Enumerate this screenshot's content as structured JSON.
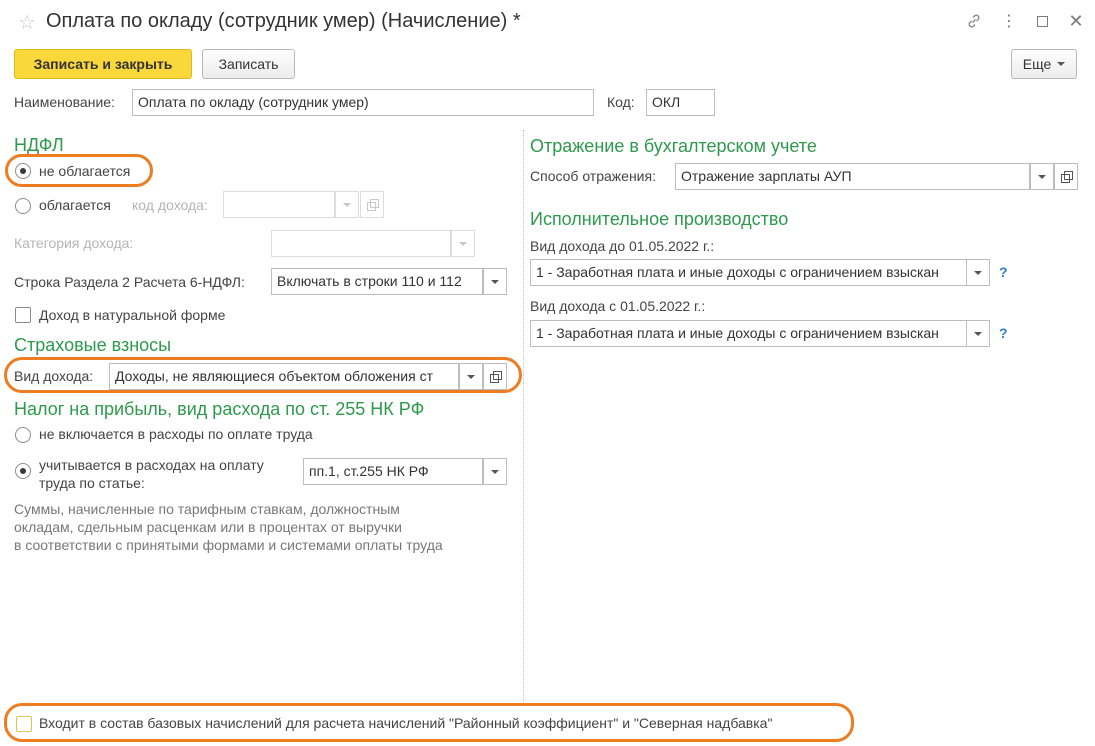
{
  "window": {
    "title": "Оплата по окладу (сотрудник умер) (Начисление) *",
    "icons": [
      "star-icon",
      "link-icon",
      "more-icon",
      "maximize-icon",
      "close-icon"
    ]
  },
  "toolbar": {
    "save_close_label": "Записать и закрыть",
    "save_label": "Записать",
    "more_label": "Еще"
  },
  "header": {
    "name_label": "Наименование:",
    "name_value": "Оплата по окладу (сотрудник умер)",
    "code_label": "Код:",
    "code_value": "ОКЛ"
  },
  "ndfl": {
    "title": "НДФЛ",
    "not_taxed_label": "не облагается",
    "taxed_label": "облагается",
    "income_code_label": "код дохода:",
    "income_category_label": "Категория дохода:",
    "section2_label": "Строка Раздела 2 Расчета 6-НДФЛ:",
    "section2_value": "Включать в строки 110 и 112",
    "in_kind_label": "Доход в натуральной форме",
    "selected": "не облагается"
  },
  "insurance": {
    "title": "Страховые взносы",
    "income_type_label": "Вид дохода:",
    "income_type_value": "Доходы, не являющиеся объектом обложения ст"
  },
  "profit_tax": {
    "title": "Налог на прибыль, вид расхода по ст. 255 НК РФ",
    "option1_label": "не включается в расходы по оплате труда",
    "option2_line1": "учитывается в расходах на оплату",
    "option2_line2": "труда по статье:",
    "article_value": "пп.1, ст.255 НК РФ",
    "note_line1": "Суммы, начисленные по тарифным ставкам, должностным",
    "note_line2": "окладам, сдельным расценкам или в процентах от выручки",
    "note_line3": "в соответствии с принятыми формами и системами оплаты труда"
  },
  "accounting": {
    "title": "Отражение в бухгалтерском учете",
    "method_label": "Способ отражения:",
    "method_value": "Отражение зарплаты АУП"
  },
  "enforcement": {
    "title": "Исполнительное производство",
    "before_label": "Вид дохода до 01.05.2022 г.:",
    "before_value": "1 - Заработная плата и иные доходы с ограничением взыскан",
    "after_label": "Вид дохода с 01.05.2022 г.:",
    "after_value": "1 - Заработная плата и иные доходы с ограничением взыскан",
    "help_symbol": "?"
  },
  "footer": {
    "base_accruals_label": "Входит в состав базовых начислений для расчета начислений \"Районный коэффициент\" и \"Северная надбавка\""
  },
  "colors": {
    "section_title": "#2d9a4c",
    "primary_button": "#fad83b",
    "highlight_oval": "#ee7d22",
    "help": "#2f7fd1"
  }
}
